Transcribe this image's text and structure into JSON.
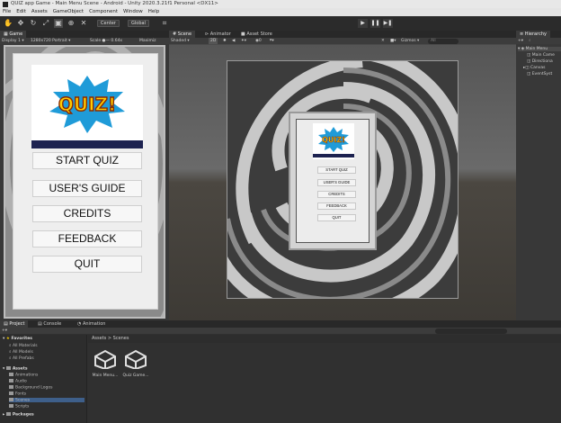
{
  "window": {
    "title": "QUIZ app Game - Main Menu Scene - Android - Unity 2020.3.21f1 Personal <DX11>"
  },
  "menu": [
    "File",
    "Edit",
    "Assets",
    "GameObject",
    "Component",
    "Window",
    "Help"
  ],
  "toolbar": {
    "tools": [
      "hand-icon",
      "move-icon",
      "rotate-icon",
      "scale-icon",
      "rect-icon",
      "transform-icon",
      "custom-tool-icon"
    ],
    "pivot_label": "Center",
    "space_label": "Global",
    "play_icons": [
      "play-icon",
      "pause-icon",
      "step-icon"
    ]
  },
  "game_panel": {
    "tab": "Game",
    "display": "Display 1",
    "resolution": "1280x720 Portrait",
    "scale_label": "Scale",
    "scale_value": "0.64x",
    "maximize": "Maximiz"
  },
  "quiz": {
    "logo_text": "QUIZ!",
    "buttons": [
      "START QUIZ",
      "USER'S GUIDE",
      "CREDITS",
      "FEEDBACK",
      "QUIT"
    ]
  },
  "scene_panel": {
    "tabs": [
      "Scene",
      "Animator",
      "Asset Store"
    ],
    "shading": "Shaded",
    "mode_2d": "2D",
    "gizmos": "Gizmos",
    "search_placeholder": "All"
  },
  "hierarchy": {
    "tab": "Hierarchy",
    "scene_name": "Main Menu",
    "items": [
      "Main Came",
      "Directiona",
      "Canvas",
      "EventSyst"
    ]
  },
  "project_panel": {
    "tabs": [
      "Project",
      "Console",
      "Animation"
    ],
    "favorites": {
      "label": "Favorites",
      "items": [
        "All Materials",
        "All Models",
        "All Prefabs"
      ]
    },
    "assets": {
      "label": "Assets",
      "items": [
        "Animations",
        "Audio",
        "Background Logos",
        "Fonts",
        "Scenes",
        "Scripts"
      ]
    },
    "packages_label": "Packages",
    "breadcrumb": "Assets > Scenes",
    "files": [
      "Main Menu...",
      "Quiz Game..."
    ]
  }
}
